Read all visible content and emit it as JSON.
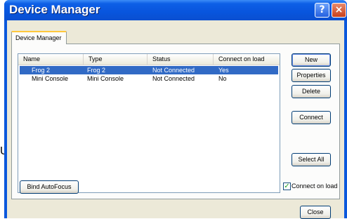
{
  "window": {
    "title": "Device Manager",
    "help_glyph": "?",
    "close_glyph": "×"
  },
  "tab": {
    "label": "Device Manager"
  },
  "table": {
    "columns": [
      "Name",
      "Type",
      "Status",
      "Connect on load"
    ],
    "rows": [
      {
        "name": "Frog 2",
        "type": "Frog 2",
        "status": "Not Connected",
        "connect_on_load": "Yes",
        "selected": true
      },
      {
        "name": "Mini Console",
        "type": "Mini Console",
        "status": "Not Connected",
        "connect_on_load": "No",
        "selected": false
      }
    ]
  },
  "buttons": {
    "new": "New",
    "properties": "Properties",
    "delete": "Delete",
    "connect": "Connect",
    "select_all": "Select All",
    "bind_autofocus": "Bind AutoFocus",
    "close": "Close"
  },
  "checkbox": {
    "label": "Connect on load",
    "checked": true,
    "check_glyph": "✓"
  },
  "stray_char": "U",
  "colors": {
    "titlebar": "#0855dd",
    "selection": "#316ac5",
    "dialog_bg": "#ece9d8",
    "tab_highlight": "#ffc83c"
  }
}
